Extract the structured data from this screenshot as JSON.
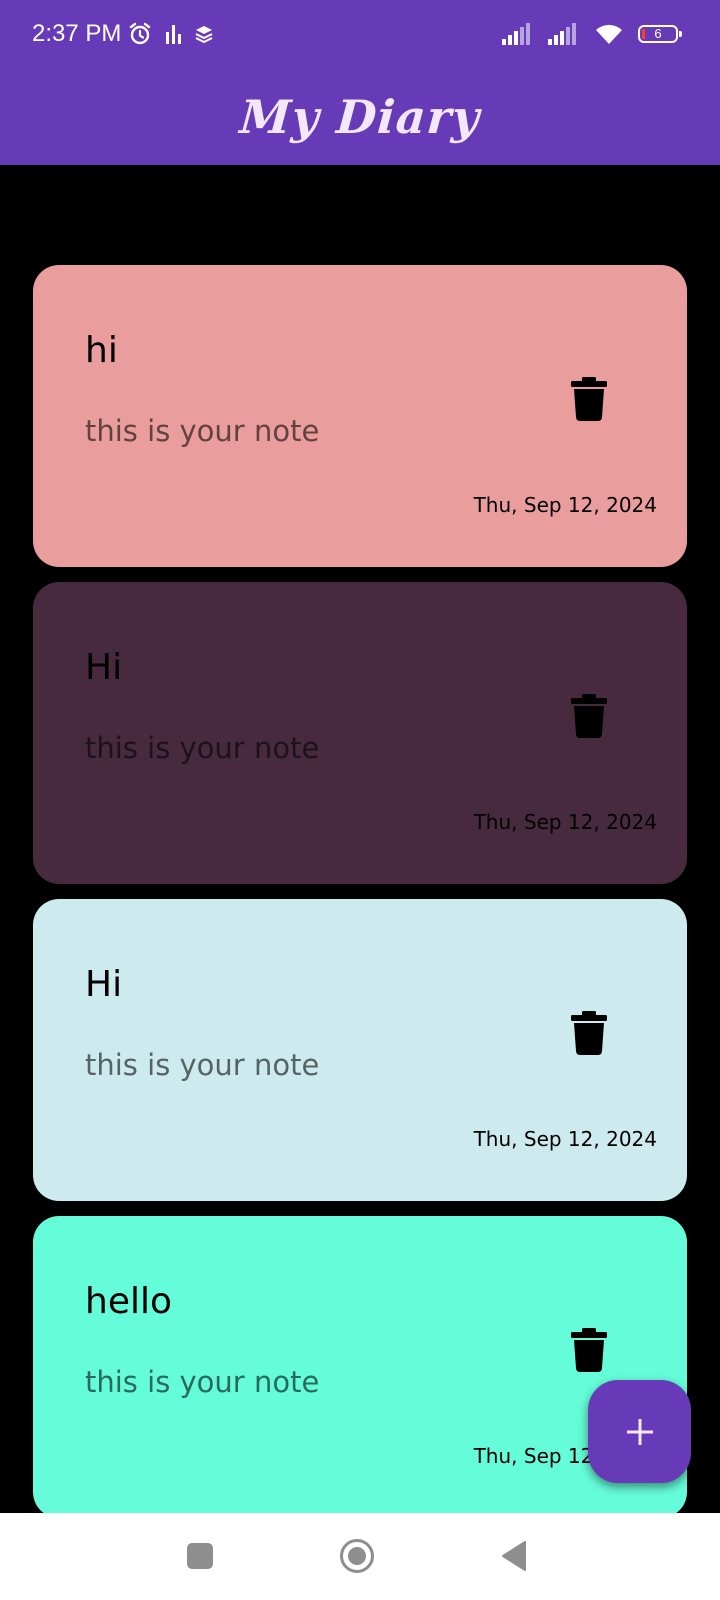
{
  "status_bar": {
    "time": "2:37 PM",
    "battery_level": "6",
    "left_icons": [
      "alarm-icon",
      "data-activity-icon",
      "layers-icon"
    ],
    "right_icons": [
      "signal-icon",
      "signal-icon",
      "wifi-icon",
      "battery-icon"
    ]
  },
  "app": {
    "title": "My Diary",
    "accent_color": "#673ab7"
  },
  "notes": [
    {
      "title": "hi",
      "body": "this is your note",
      "date": "Thu, Sep 12, 2024",
      "color": "#e99d9c"
    },
    {
      "title": "Hi",
      "body": "this is your note",
      "date": "Thu, Sep 12, 2024",
      "color": "#472a3e"
    },
    {
      "title": "Hi",
      "body": "this is your note",
      "date": "Thu, Sep 12, 2024",
      "color": "#cdebef"
    },
    {
      "title": "hello",
      "body": "this is your note",
      "date": "Thu, Sep 12, 2024",
      "color": "#65fdd9"
    }
  ],
  "fab": {
    "icon": "plus-icon"
  },
  "nav_bar": {
    "icons": [
      "recents-icon",
      "home-icon",
      "back-icon"
    ]
  }
}
